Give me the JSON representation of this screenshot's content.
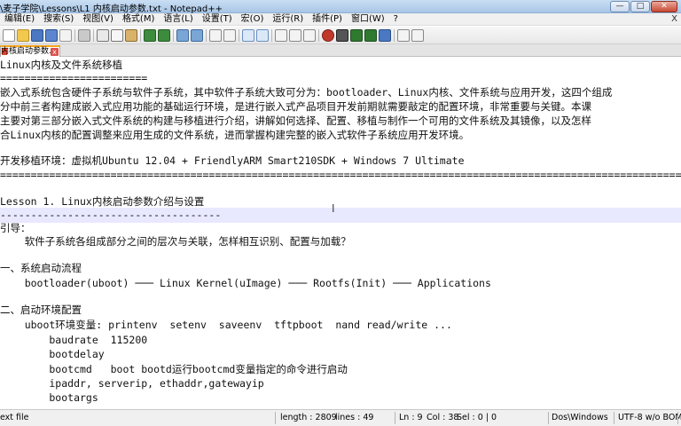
{
  "window": {
    "title": "\\麦子学院\\Lessons\\L1 内核启动参数.txt - Notepad++",
    "minimize": "—",
    "maximize": "□",
    "close": "✕"
  },
  "menu": {
    "items": [
      "编辑(E)",
      "搜索(S)",
      "视图(V)",
      "格式(M)",
      "语言(L)",
      "设置(T)",
      "宏(O)",
      "运行(R)",
      "插件(P)",
      "窗口(W)",
      "?"
    ],
    "close_label": "X"
  },
  "toolbar": {
    "icons": [
      "new-icon",
      "open-icon",
      "save-icon",
      "save-all-icon",
      "close-icon",
      "close-all-icon",
      "print-icon",
      "cut-icon",
      "copy-icon",
      "paste-icon",
      "undo-icon",
      "redo-icon",
      "find-icon",
      "replace-icon",
      "zoom-in-icon",
      "zoom-out-icon",
      "sync-v-icon",
      "sync-h-icon",
      "wrap-icon",
      "all-chars-icon",
      "indent-guide-icon",
      "lang-icon",
      "doc-map-icon",
      "func-list-icon",
      "record-icon",
      "stop-icon",
      "play-icon",
      "play-multi-icon",
      "save-macro-icon",
      "spellcheck-icon",
      "abc-icon",
      "misc-icon"
    ]
  },
  "tab": {
    "label": "内核启动参数.txt",
    "close": "x"
  },
  "editor": {
    "lines": [
      "Linux内核及文件系统移植",
      "========================",
      "嵌入式系统包含硬件子系统与软件子系统，其中软件子系统大致可分为：bootloader、Linux内核、文件系统与应用开发，这四个组成",
      "分中前三者构建成嵌入式应用功能的基础运行环境，是进行嵌入式产品项目开发前期就需要敲定的配置环境，非常重要与关键。本课",
      "主要对第三部分嵌入式文件系统的构建与移植进行介绍，讲解如何选择、配置、移植与制作一个可用的文件系统及其镜像，以及怎样",
      "合Linux内核的配置调整来应用生成的文件系统，进而掌握构建完整的嵌入式软件子系统应用开发环境。",
      "",
      "开发移植环境：虚拟机Ubuntu 12.04 + FriendlyARM Smart210SDK + Windows 7 Ultimate",
      "==================================================================================================================",
      "",
      "Lesson 1. Linux内核启动参数介绍与设置",
      "------------------------------------",
      "引导：",
      "    软件子系统各组成部分之间的层次与关联，怎样相互识别、配置与加载？",
      "",
      "一、系统启动流程",
      "    bootloader(uboot) ─── Linux Kernel(uImage) ─── Rootfs(Init) ─── Applications",
      "",
      "二、启动环境配置",
      "    uboot环境变量: printenv  setenv  saveenv  tftpboot  nand read/write ...",
      "        baudrate  115200",
      "        bootdelay",
      "        bootcmd   boot bootd运行bootcmd变量指定的命令进行启动",
      "        ipaddr, serverip, ethaddr,gatewayip",
      "        bootargs"
    ],
    "caret": "I"
  },
  "status": {
    "file_type": "ext file",
    "length": "length : 2809",
    "lines": "lines : 49",
    "ln": "Ln : 9",
    "col": "Col : 38",
    "sel": "Sel : 0 | 0",
    "eol": "Dos\\Windows",
    "encoding": "UTF-8 w/o BOM",
    "mode": "INS"
  }
}
